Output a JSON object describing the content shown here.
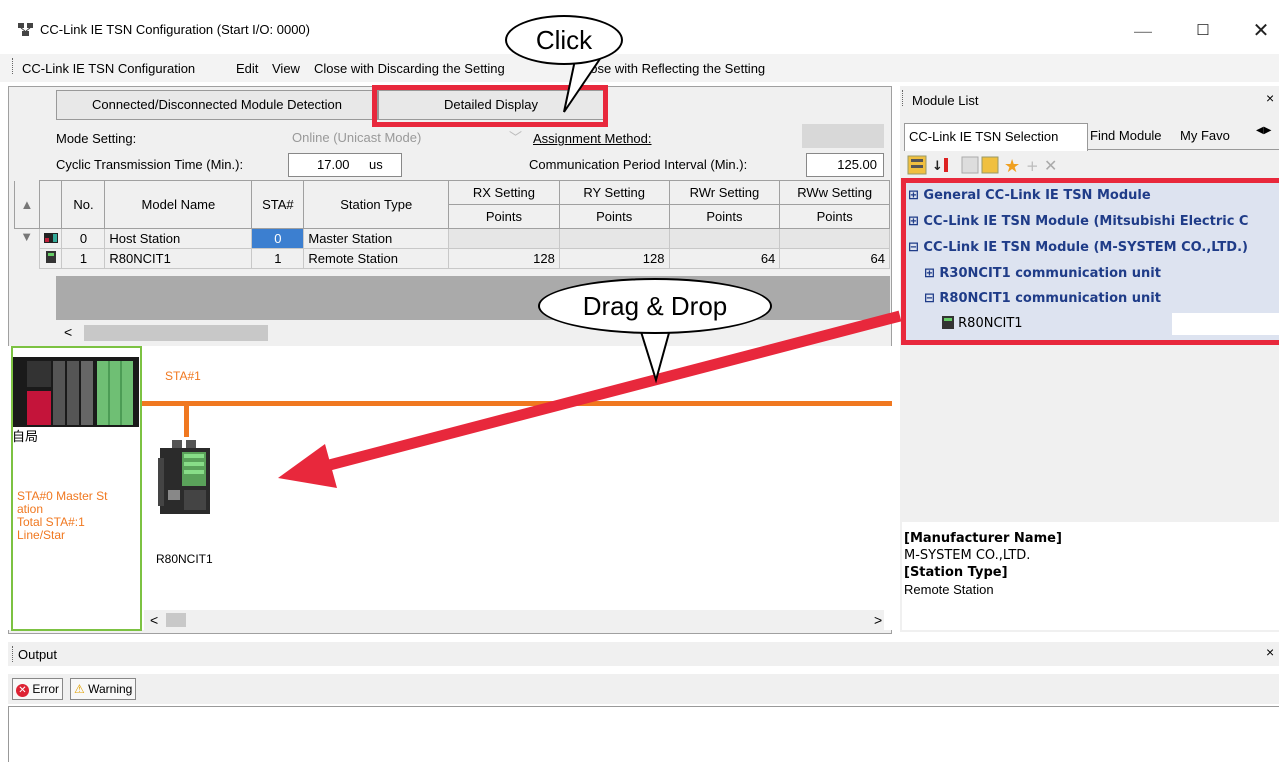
{
  "window": {
    "title": "CC-Link IE TSN Configuration (Start I/O: 0000)",
    "minimize": "—",
    "maximize": "☐",
    "close": "✕"
  },
  "menu": {
    "items": [
      "CC-Link IE TSN Configuration",
      "Edit",
      "View",
      "Close with Discarding the Setting",
      "Close with Reflecting the Setting"
    ]
  },
  "toolbar": {
    "connected_label": "Connected/Disconnected Module Detection",
    "detailed_label": "Detailed Display"
  },
  "settings": {
    "mode_label": "Mode Setting:",
    "mode_value": "Online (Unicast Mode)",
    "assignment_label": "Assignment Method:",
    "cyclic_label": "Cyclic Transmission Time (Min.):",
    "cyclic_value": "17.00",
    "cyclic_unit": "us",
    "comm_label": "Communication Period Interval (Min.):",
    "comm_value": "125.00"
  },
  "table": {
    "headers": [
      "No.",
      "Model Name",
      "STA#",
      "Station Type",
      "RX Setting",
      "RY Setting",
      "RWr Setting",
      "RWw Setting"
    ],
    "subheaders": [
      "Points",
      "Points",
      "Points",
      "Points"
    ],
    "rows": [
      {
        "no": "0",
        "model": "Host Station",
        "sta": "0",
        "type": "Master Station",
        "rx": "",
        "ry": "",
        "rwr": "",
        "rww": ""
      },
      {
        "no": "1",
        "model": "R80NCIT1",
        "sta": "1",
        "type": "Remote Station",
        "rx": "128",
        "ry": "128",
        "rwr": "64",
        "rww": "64"
      }
    ]
  },
  "network": {
    "sta1_label": "STA#1",
    "host_label": "自局",
    "host_info": [
      "STA#0  Master St",
      "ation",
      "Total STA#:1",
      "Line/Star"
    ],
    "device_label": "R80NCIT1"
  },
  "module_list": {
    "title": "Module List",
    "tabs": [
      "CC-Link IE TSN Selection",
      "Find Module",
      "My Favo"
    ],
    "tree": [
      "General CC-Link IE TSN Module",
      "CC-Link IE TSN Module (Mitsubishi Electric C",
      "CC-Link IE TSN Module (M-SYSTEM CO.,LTD.)",
      "R30NCIT1 communication unit",
      "R80NCIT1 communication unit",
      "R80NCIT1"
    ],
    "info": {
      "manufacturer_label": "[Manufacturer Name]",
      "manufacturer_value": "M-SYSTEM CO.,LTD.",
      "station_type_label": "[Station Type]",
      "station_type_value": "Remote Station"
    }
  },
  "output": {
    "title": "Output",
    "error_label": "Error",
    "warning_label": "Warning"
  },
  "callouts": {
    "click": "Click",
    "drag": "Drag & Drop"
  },
  "colors": {
    "highlight": "#e8283c",
    "bus": "#f07820",
    "tree_text": "#1f3c88",
    "host_border": "#7cc242"
  }
}
